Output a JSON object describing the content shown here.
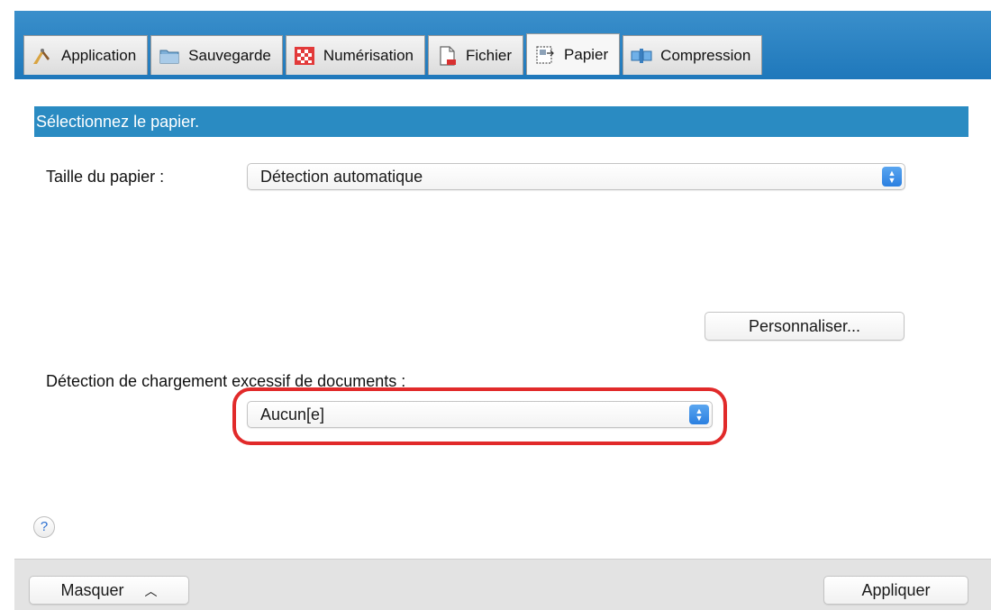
{
  "tabs": [
    {
      "label": "Application",
      "icon": "application-icon",
      "active": false
    },
    {
      "label": "Sauvegarde",
      "icon": "folder-icon",
      "active": false
    },
    {
      "label": "Numérisation",
      "icon": "scan-icon",
      "active": false
    },
    {
      "label": "Fichier",
      "icon": "file-icon",
      "active": false
    },
    {
      "label": "Papier",
      "icon": "paper-icon",
      "active": true
    },
    {
      "label": "Compression",
      "icon": "compression-icon",
      "active": false
    }
  ],
  "section": {
    "title": "Sélectionnez le papier."
  },
  "paper_size": {
    "label": "Taille du papier :",
    "value": "Détection automatique"
  },
  "customize_button": "Personnaliser...",
  "overload": {
    "label": "Détection de chargement excessif de documents :",
    "value": "Aucun[e]"
  },
  "help": "?",
  "footer": {
    "hide_button": "Masquer",
    "apply_button": "Appliquer"
  },
  "colors": {
    "accent": "#2a8bc2",
    "highlight": "#e12a2a",
    "tabbar": "#1f78bb"
  }
}
